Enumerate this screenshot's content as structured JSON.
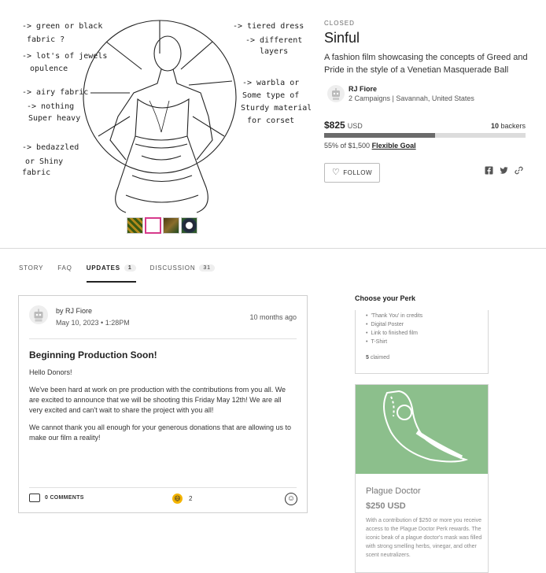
{
  "campaign": {
    "status": "CLOSED",
    "title": "Sinful",
    "tagline": "A fashion film showcasing the concepts of Greed and Pride in the style of a Venetian Masquerade Ball",
    "owner_name": "RJ Fiore",
    "owner_meta": "2 Campaigns | Savannah, United States",
    "amount": "$825",
    "currency": "USD",
    "backers_count": "10",
    "backers_label": "backers",
    "progress_fraction": 0.55,
    "goal_text": "55% of $1,500",
    "goal_type": "Flexible Goal",
    "follow_label": "FOLLOW",
    "share_icons": [
      "facebook-icon",
      "twitter-icon",
      "link-icon"
    ]
  },
  "sketch_notes": {
    "left": [
      "-> green or black",
      "fabric ?",
      "-> lot's of jewels",
      "opulence",
      "-> airy fabric",
      "-> nothing",
      "Super heavy",
      "-> bedazzled",
      "or Shiny",
      "fabric"
    ],
    "right": [
      "-> tiered dress",
      "-> different",
      "layers",
      "-> warbla or",
      "Some type of",
      "Sturdy material",
      "for corset"
    ]
  },
  "tabs": [
    {
      "label": "STORY"
    },
    {
      "label": "FAQ"
    },
    {
      "label": "UPDATES",
      "count": "1",
      "active": true
    },
    {
      "label": "DISCUSSION",
      "count": "31"
    }
  ],
  "update": {
    "author": "by RJ Fiore",
    "date": "May 10, 2023 • 1:28PM",
    "ago": "10 months ago",
    "title": "Beginning Production Soon!",
    "paragraphs": [
      "Hello Donors!",
      "We've been hard at work on pre production with the contributions from you all. We are excited to announce that we will be shooting this Friday May 12th! We are all very excited and can't wait to share the project with you all!",
      "We cannot thank you all enough for your generous donations that are allowing us to make our film a reality!"
    ],
    "comments_label": "0 COMMENTS",
    "reaction_count": "2"
  },
  "perks": {
    "heading": "Choose your Perk",
    "perk1_items": [
      "'Thank You' in credits",
      "Digital Poster",
      "Link to finished film",
      "T-Shirt"
    ],
    "perk1_claimed_count": "5",
    "perk1_claimed_label": "claimed",
    "perk2_name": "Plague Doctor",
    "perk2_price": "$250 USD",
    "perk2_desc": "With a contribution of $250 or more you receive access to the Plague Doctor Perk rewards. The iconic beak of a plague doctor's mask was filled with strong smelling herbs, vinegar, and other scent neutralizers."
  },
  "colors": {
    "progress_fill": "#6b6b6b",
    "progress_track": "#dcdcdc",
    "perk_image_green": "#8cbf8c",
    "reaction_yellow": "#f4b400"
  }
}
